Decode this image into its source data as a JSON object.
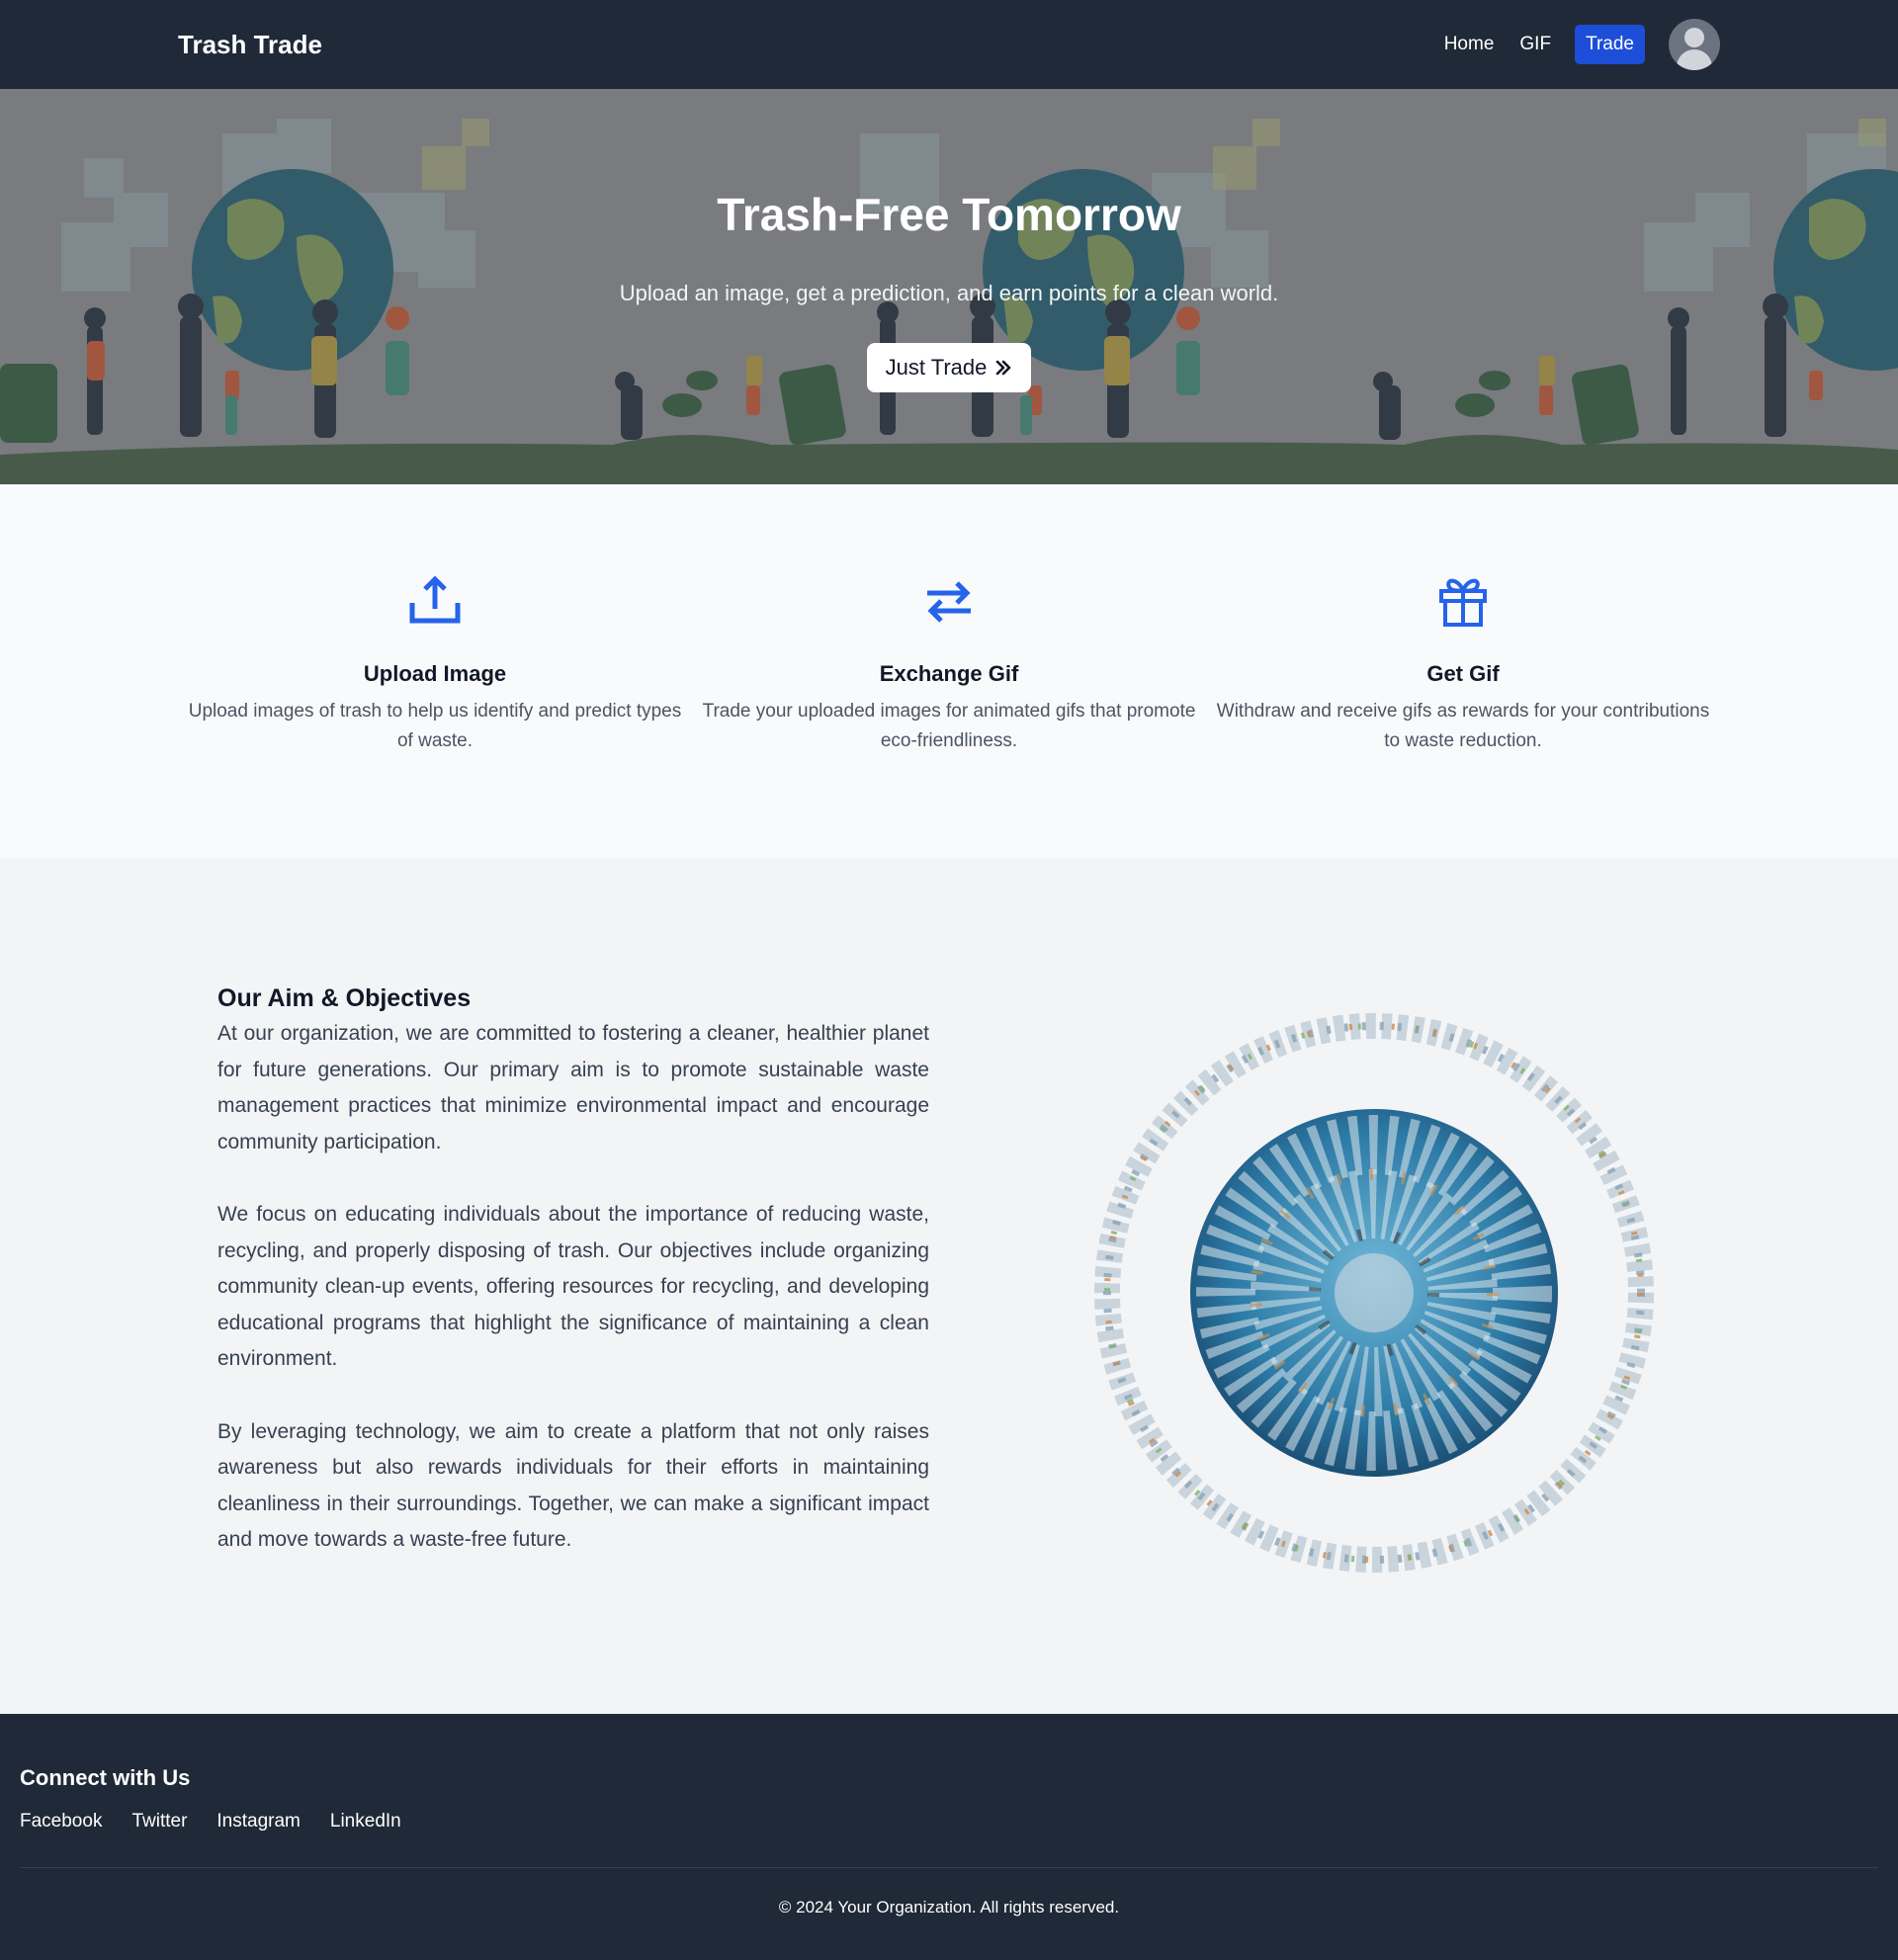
{
  "nav": {
    "brand": "Trash Trade",
    "links": [
      "Home",
      "GIF",
      "Trade"
    ],
    "active": "Trade"
  },
  "hero": {
    "title": "Trash-Free Tomorrow",
    "subtitle": "Upload an image, get a prediction, and earn points for a clean world.",
    "button_label": "Just Trade",
    "button_icon": "double-chevron-right-icon"
  },
  "features": [
    {
      "icon": "upload-icon",
      "title": "Upload Image",
      "description": "Upload images of trash to help us identify and predict types of waste."
    },
    {
      "icon": "exchange-icon",
      "title": "Exchange Gif",
      "description": "Trade your uploaded images for animated gifs that promote eco-friendliness."
    },
    {
      "icon": "gift-icon",
      "title": "Get Gif",
      "description": "Withdraw and receive gifs as rewards for your contributions to waste reduction."
    }
  ],
  "aim": {
    "heading": "Our Aim & Objectives",
    "paragraphs": [
      "At our organization, we are committed to fostering a cleaner, healthier planet for future generations. Our primary aim is to promote sustainable waste management practices that minimize environmental impact and encourage community participation.",
      "We focus on educating individuals about the importance of reducing waste, recycling, and properly disposing of trash. Our objectives include organizing community clean-up events, offering resources for recycling, and developing educational programs that highlight the significance of maintaining a clean environment.",
      "By leveraging technology, we aim to create a platform that not only raises awareness but also rewards individuals for their efforts in maintaining cleanliness in their surroundings. Together, we can make a significant impact and move towards a waste-free future."
    ]
  },
  "footer": {
    "heading": "Connect with Us",
    "social": [
      "Facebook",
      "Twitter",
      "Instagram",
      "LinkedIn"
    ],
    "copyright": "© 2024 Your Organization. All rights reserved."
  },
  "colors": {
    "nav_bg": "#1f2937",
    "accent": "#1d4ed8",
    "icon_blue": "#2563eb",
    "hero_ground": "#3f5b3f"
  }
}
